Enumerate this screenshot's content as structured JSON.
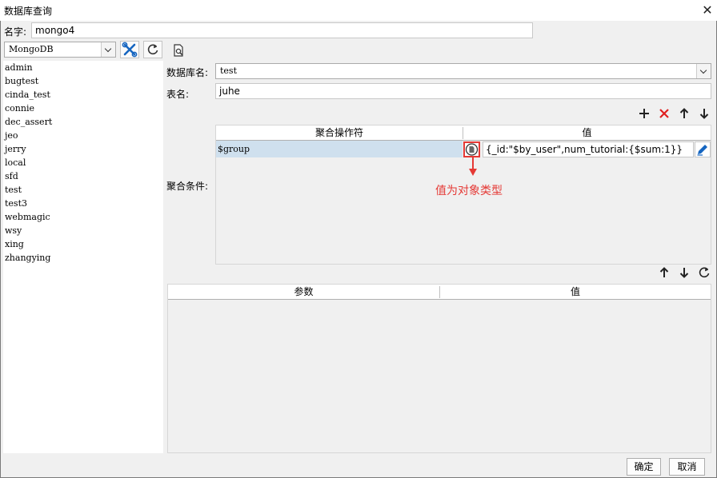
{
  "window": {
    "title": "数据库查询"
  },
  "name_field": {
    "label": "名字:",
    "value": "mongo4"
  },
  "db_type": {
    "selected": "MongoDB"
  },
  "databases": [
    "admin",
    "bugtest",
    "cinda_test",
    "connie",
    "dec_assert",
    "jeo",
    "jerry",
    "local",
    "sfd",
    "test",
    "test3",
    "webmagic",
    "wsy",
    "xing",
    "zhangying"
  ],
  "form": {
    "db_label": "数据库名:",
    "db_value": "test",
    "table_label": "表名:",
    "table_value": "juhe",
    "agg_label": "聚合条件:"
  },
  "agg_table": {
    "col_operator": "聚合操作符",
    "col_value": "值",
    "rows": [
      {
        "operator": "$group",
        "value": "{_id:\"$by_user\",num_tutorial:{$sum:1}}"
      }
    ]
  },
  "annotation": {
    "text": "值为对象类型",
    "color": "#e53935"
  },
  "param_table": {
    "col_param": "参数",
    "col_value": "值"
  },
  "buttons": {
    "ok": "确定",
    "cancel": "取消"
  },
  "colors": {
    "selected_row": "#cfe0ee",
    "accent_blue": "#1565c0",
    "delete_red": "#e02020"
  }
}
